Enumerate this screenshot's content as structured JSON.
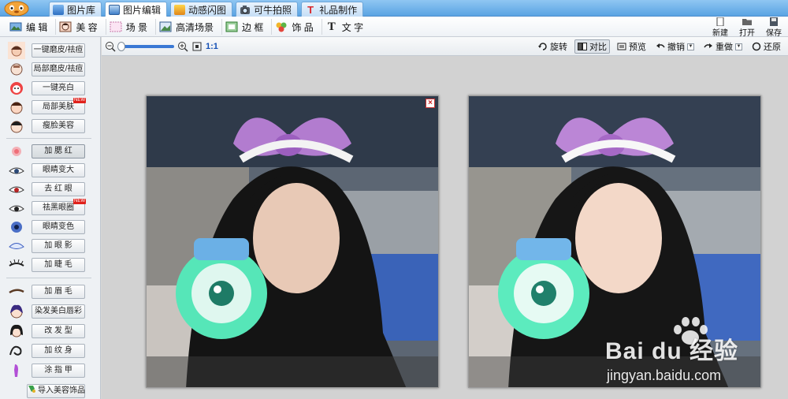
{
  "tabs": [
    {
      "label": "图片库",
      "icon": "gallery-icon",
      "active": false
    },
    {
      "label": "图片编辑",
      "icon": "image-edit-icon",
      "active": true
    },
    {
      "label": "动感闪图",
      "icon": "flash-gif-icon",
      "active": false
    },
    {
      "label": "可牛拍照",
      "icon": "camera-icon",
      "active": false
    },
    {
      "label": "礼品制作",
      "icon": "gift-t-icon",
      "active": false
    }
  ],
  "tools": [
    {
      "label": "编 辑",
      "icon": "edit-image-icon"
    },
    {
      "label": "美 容",
      "icon": "beauty-face-icon"
    },
    {
      "label": "场 景",
      "icon": "scene-icon"
    },
    {
      "label": "高清场景",
      "icon": "hd-scene-icon"
    },
    {
      "label": "边 框",
      "icon": "frame-icon"
    },
    {
      "label": "饰 品",
      "icon": "ornament-icon"
    },
    {
      "label": "文 字",
      "icon": "text-t-icon"
    }
  ],
  "file_buttons": [
    {
      "label": "新建",
      "icon": "new-file-icon"
    },
    {
      "label": "打开",
      "icon": "open-folder-icon"
    },
    {
      "label": "保存",
      "icon": "save-disk-icon"
    }
  ],
  "left_groups": {
    "group1": [
      {
        "label": "一键磨皮/祛痘",
        "icon": "smooth-skin-icon",
        "new": false
      },
      {
        "label": "局部磨皮/祛痘",
        "icon": "partial-smooth-icon",
        "new": false
      },
      {
        "label": "一键亮白",
        "icon": "whiten-icon",
        "new": false
      },
      {
        "label": "局部美肤",
        "icon": "partial-beautify-icon",
        "new": true
      },
      {
        "label": "瘦脸美容",
        "icon": "slim-face-icon",
        "new": false
      }
    ],
    "group2": [
      {
        "label": "加 腮 红",
        "icon": "blush-icon",
        "new": false,
        "pressed": true
      },
      {
        "label": "眼睛变大",
        "icon": "eye-enlarge-icon",
        "new": false
      },
      {
        "label": "去 红 眼",
        "icon": "red-eye-icon",
        "new": false
      },
      {
        "label": "祛黑眼圈",
        "icon": "dark-circle-icon",
        "new": true
      },
      {
        "label": "眼睛变色",
        "icon": "eye-color-icon",
        "new": false
      },
      {
        "label": "加 眼 影",
        "icon": "eye-shadow-icon",
        "new": false
      },
      {
        "label": "加 睫 毛",
        "icon": "eyelash-icon",
        "new": false
      }
    ],
    "group3": [
      {
        "label": "加 眉 毛",
        "icon": "eyebrow-icon",
        "new": false
      },
      {
        "label": "染发美白唇彩",
        "icon": "hair-dye-icon",
        "new": false
      },
      {
        "label": "改 发 型",
        "icon": "hairstyle-icon",
        "new": false
      },
      {
        "label": "加 纹 身",
        "icon": "tattoo-icon",
        "new": false
      },
      {
        "label": "涂 指 甲",
        "icon": "nail-polish-icon",
        "new": false
      }
    ]
  },
  "import_button": {
    "label": "导入美容饰品",
    "icon": "import-ornament-icon"
  },
  "new_badge": "NEW",
  "zoom": {
    "ratio_label": "1:1",
    "level": 0
  },
  "view_buttons": [
    {
      "label": "旋转",
      "icon": "rotate-icon",
      "active": false,
      "dropdown": false
    },
    {
      "label": "对比",
      "icon": "compare-icon",
      "active": true,
      "dropdown": false
    },
    {
      "label": "预览",
      "icon": "preview-icon",
      "active": false,
      "dropdown": false
    },
    {
      "label": "撤销",
      "icon": "undo-icon",
      "active": false,
      "dropdown": true
    },
    {
      "label": "重做",
      "icon": "redo-icon",
      "active": false,
      "dropdown": true
    },
    {
      "label": "还原",
      "icon": "restore-icon",
      "active": false,
      "dropdown": false
    }
  ],
  "photos": {
    "close_glyph": "×"
  },
  "watermark": {
    "brand": "Bai du 经验",
    "url": "jingyan.baidu.com"
  },
  "colors": {
    "accent": "#3a78d4",
    "tabbar": "#5aa4e3",
    "badge": "#e0221c"
  }
}
